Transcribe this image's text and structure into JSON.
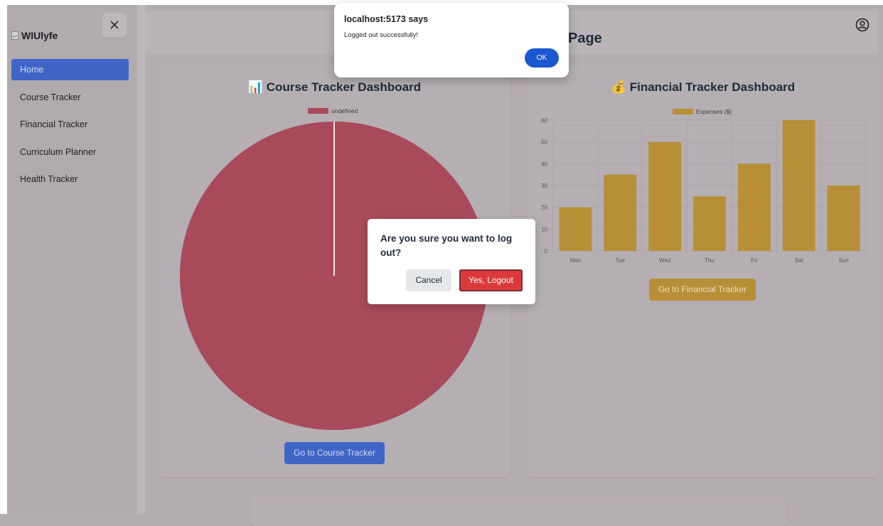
{
  "app": {
    "brand": "WIUlyfe"
  },
  "sidebar": {
    "items": [
      {
        "label": "Home",
        "active": true
      },
      {
        "label": "Course Tracker"
      },
      {
        "label": "Financial Tracker"
      },
      {
        "label": "Curriculum Planner"
      },
      {
        "label": "Health Tracker"
      }
    ]
  },
  "header": {
    "title_visible": "Page"
  },
  "course_card": {
    "title": "📊 Course Tracker Dashboard",
    "button": "Go to Course Tracker"
  },
  "financial_card": {
    "title": "💰 Financial Tracker Dashboard",
    "button": "Go to Financial Tracker"
  },
  "chart_data": [
    {
      "type": "pie",
      "legend": [
        "undefined"
      ],
      "values": [
        1
      ],
      "colors": [
        "#a84a5a"
      ]
    },
    {
      "type": "bar",
      "categories": [
        "Mon",
        "Tue",
        "Wed",
        "Thu",
        "Fri",
        "Sat",
        "Sun"
      ],
      "series": [
        {
          "name": "Expenses ($)",
          "values": [
            20,
            35,
            50,
            25,
            40,
            60,
            30
          ]
        }
      ],
      "ylim": [
        0,
        60
      ],
      "yticks": [
        0,
        10,
        20,
        30,
        40,
        50,
        60
      ],
      "grid": true,
      "legend_position": "top",
      "color": "#b88f37"
    }
  ],
  "alert": {
    "title": "localhost:5173 says",
    "message": "Logged out successfully!",
    "ok": "OK"
  },
  "modal": {
    "message": "Are you sure you want to log out?",
    "cancel": "Cancel",
    "confirm": "Yes, Logout"
  },
  "colors": {
    "primary": "#3f66c7",
    "danger": "#dc3a3a",
    "gold": "#b88f37"
  }
}
